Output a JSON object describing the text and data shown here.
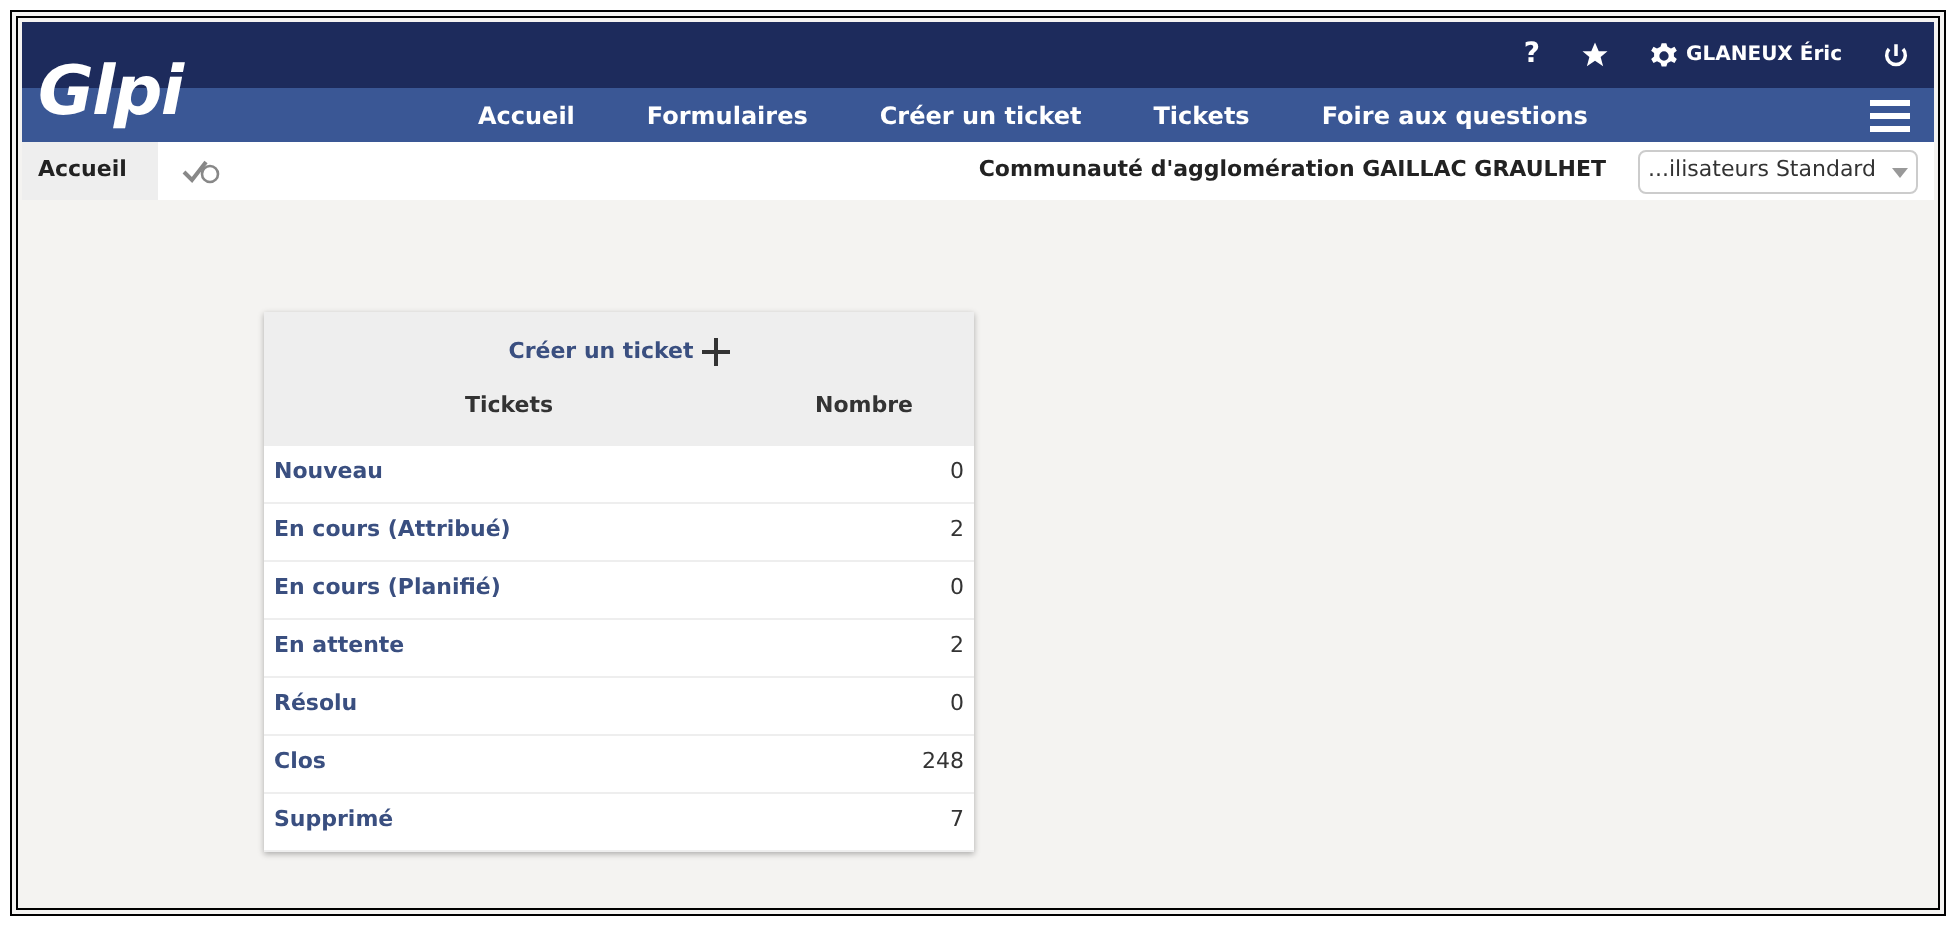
{
  "logo": "Glpi",
  "top_bar": {
    "help": "?",
    "user": "GLANEUX Éric"
  },
  "nav": [
    {
      "label": "Accueil"
    },
    {
      "label": "Formulaires"
    },
    {
      "label": "Créer un ticket"
    },
    {
      "label": "Tickets"
    },
    {
      "label": "Foire aux questions"
    }
  ],
  "breadcrumb": {
    "current": "Accueil"
  },
  "entity": "Communauté d'agglomération GAILLAC GRAULHET",
  "profile_select": {
    "value": "...ilisateurs Standard"
  },
  "card": {
    "create_link": "Créer un ticket",
    "columns": [
      "Tickets",
      "Nombre"
    ],
    "rows": [
      {
        "label": "Nouveau",
        "count": "0"
      },
      {
        "label": "En cours (Attribué)",
        "count": "2"
      },
      {
        "label": "En cours (Planifié)",
        "count": "0"
      },
      {
        "label": "En attente",
        "count": "2"
      },
      {
        "label": "Résolu",
        "count": "0"
      },
      {
        "label": "Clos",
        "count": "248"
      },
      {
        "label": "Supprimé",
        "count": "7"
      }
    ]
  }
}
